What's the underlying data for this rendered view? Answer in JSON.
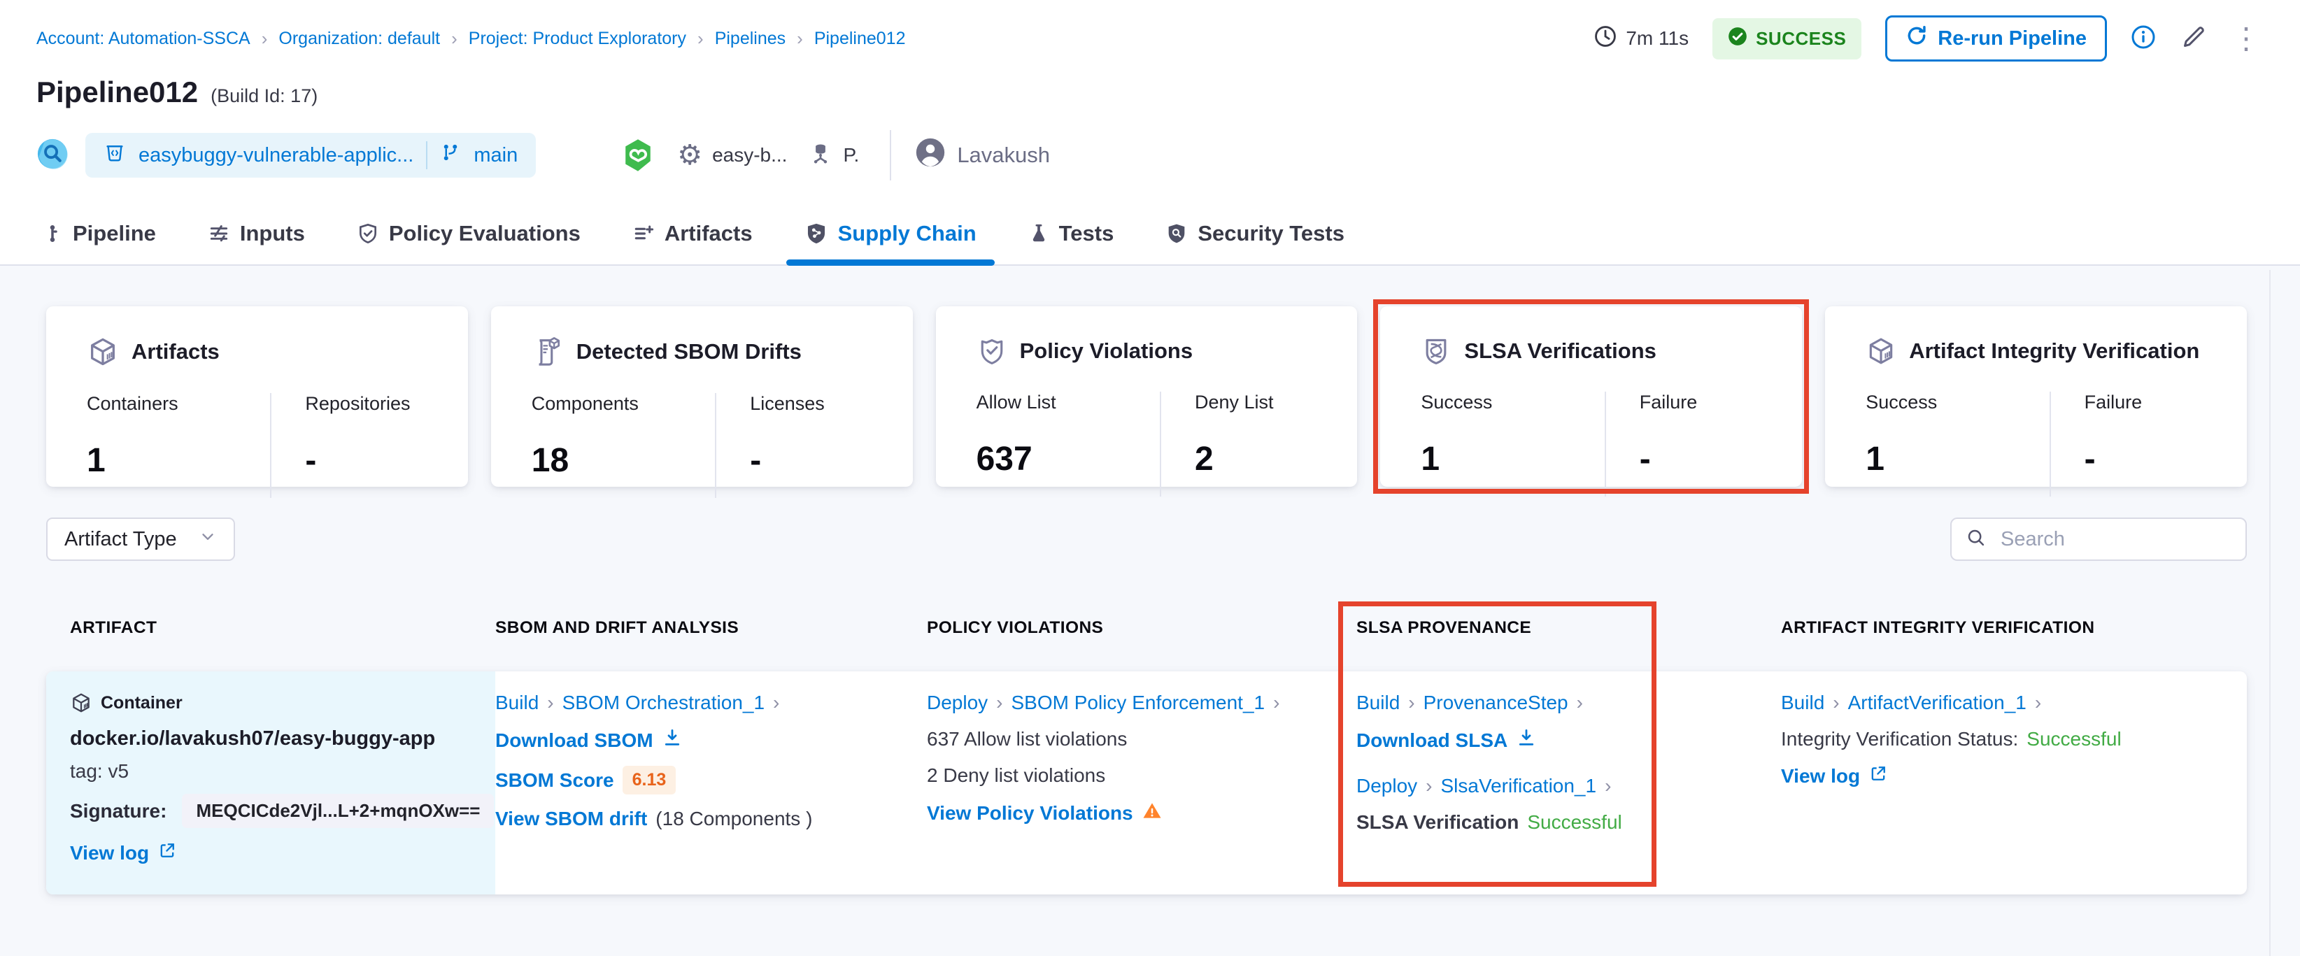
{
  "colors": {
    "accent": "#0278d5",
    "success_green": "#42ab45",
    "badge_green": "#1b841d",
    "annotation_red": "#e5432c",
    "warning_orange": "#ff832b",
    "score_orange": "#e8631a"
  },
  "breadcrumb": {
    "items": [
      "Account: Automation-SSCA",
      "Organization: default",
      "Project: Product Exploratory",
      "Pipelines",
      "Pipeline012"
    ]
  },
  "header": {
    "duration": "7m 11s",
    "status_badge": "SUCCESS",
    "rerun_button": "Re-run Pipeline",
    "title": "Pipeline012",
    "build_id": "(Build Id: 17)",
    "repo_name": "easybuggy-vulnerable-applic...",
    "branch_name": "main",
    "pipeline_ref": "easy-b...",
    "trigger_ref": "P.",
    "user_name": "Lavakush"
  },
  "tabs": [
    {
      "label": "Pipeline"
    },
    {
      "label": "Inputs"
    },
    {
      "label": "Policy Evaluations"
    },
    {
      "label": "Artifacts"
    },
    {
      "label": "Supply Chain"
    },
    {
      "label": "Tests"
    },
    {
      "label": "Security Tests"
    }
  ],
  "summary_cards": [
    {
      "title": "Artifacts",
      "stats": [
        {
          "label": "Containers",
          "value": "1"
        },
        {
          "label": "Repositories",
          "value": "-"
        }
      ]
    },
    {
      "title": "Detected SBOM Drifts",
      "stats": [
        {
          "label": "Components",
          "value": "18"
        },
        {
          "label": "Licenses",
          "value": "-"
        }
      ]
    },
    {
      "title": "Policy Violations",
      "stats": [
        {
          "label": "Allow List",
          "value": "637"
        },
        {
          "label": "Deny List",
          "value": "2"
        }
      ]
    },
    {
      "title": "SLSA Verifications",
      "stats": [
        {
          "label": "Success",
          "value": "1"
        },
        {
          "label": "Failure",
          "value": "-"
        }
      ]
    },
    {
      "title": "Artifact Integrity Verification",
      "stats": [
        {
          "label": "Success",
          "value": "1"
        },
        {
          "label": "Failure",
          "value": "-"
        }
      ]
    }
  ],
  "filters": {
    "artifact_type": "Artifact Type",
    "search_placeholder": "Search"
  },
  "table": {
    "columns": [
      "ARTIFACT",
      "SBOM AND DRIFT ANALYSIS",
      "POLICY VIOLATIONS",
      "SLSA PROVENANCE",
      "ARTIFACT INTEGRITY VERIFICATION"
    ],
    "row": {
      "artifact": {
        "type": "Container",
        "image": "docker.io/lavakush07/easy-buggy-app",
        "tag": "tag: v5",
        "signature_label": "Signature:",
        "signature": "MEQCICde2Vjl...L+2+mqnOXw==",
        "view_log": "View log"
      },
      "sbom": {
        "stage": "Build",
        "step": "SBOM Orchestration_1",
        "download": "Download SBOM",
        "score_label": "SBOM Score",
        "score": "6.13",
        "drift_link": "View SBOM drift",
        "drift_count": "(18 Components )"
      },
      "policy": {
        "stage": "Deploy",
        "step": "SBOM Policy Enforcement_1",
        "allow": "637 Allow list violations",
        "deny": "2 Deny list violations",
        "link": "View Policy Violations"
      },
      "slsa": {
        "stage1": "Build",
        "step1": "ProvenanceStep",
        "download": "Download SLSA",
        "stage2": "Deploy",
        "step2": "SlsaVerification_1",
        "status_label": "SLSA Verification",
        "status": "Successful"
      },
      "integrity": {
        "stage": "Build",
        "step": "ArtifactVerification_1",
        "status_label": "Integrity Verification Status:",
        "status": "Successful",
        "view_log": "View log"
      }
    }
  }
}
